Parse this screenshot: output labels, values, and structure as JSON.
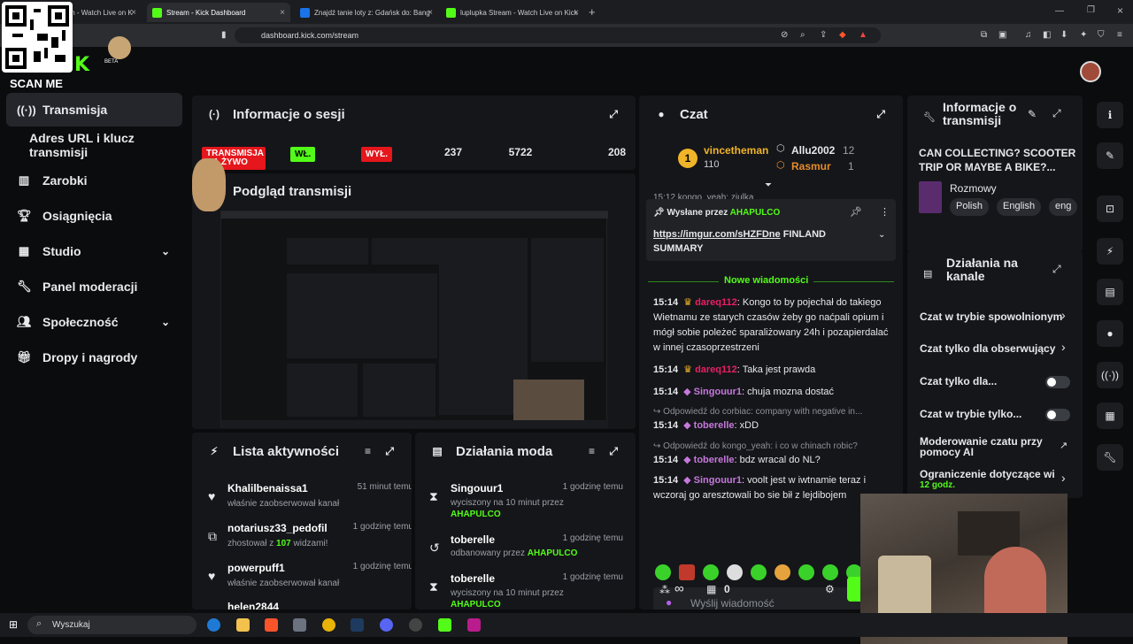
{
  "browser": {
    "tabs": [
      {
        "label": "m - Watch Live on K",
        "active": false
      },
      {
        "label": "Stream - Kick Dashboard",
        "active": true
      },
      {
        "label": "Znajdź tanie loty z: Gdańsk do: Bang",
        "active": false
      },
      {
        "label": "luplupka Stream - Watch Live on Kick",
        "active": false
      }
    ],
    "url": "dashboard.kick.com/stream"
  },
  "overlay": {
    "scan_me": "SCAN ME",
    "beta": "BETA"
  },
  "sidebar": {
    "items": [
      {
        "label": "Transmisja",
        "icon": "broadcast-icon",
        "active": true
      },
      {
        "label": "Adres URL i klucz transmisji",
        "icon": "",
        "active": false
      },
      {
        "label": "Zarobki",
        "icon": "chart-icon",
        "active": false
      },
      {
        "label": "Osiągnięcia",
        "icon": "trophy-icon",
        "active": false
      },
      {
        "label": "Studio",
        "icon": "grid-icon",
        "active": false
      },
      {
        "label": "Panel moderacji",
        "icon": "wrench-icon",
        "active": false
      },
      {
        "label": "Społeczność",
        "icon": "users-icon",
        "active": false
      },
      {
        "label": "Dropy i nagrody",
        "icon": "gift-icon",
        "active": false
      }
    ]
  },
  "session": {
    "title": "Informacje o sesji",
    "live_badge": "TRANSMISJA NA ŻYWO",
    "on": "WŁ.",
    "off": "WYŁ.",
    "stats": [
      "237",
      "5722",
      "208"
    ]
  },
  "preview": {
    "title": "Podgląd transmisji"
  },
  "activity": {
    "title": "Lista aktywności",
    "items": [
      {
        "name": "Khalilbenaissa1",
        "time": "51 minut temu",
        "desc": "właśnie zaobserwował kanał",
        "icon": "heart-icon"
      },
      {
        "name": "notariusz33_pedofil",
        "time": "1 godzinę temu",
        "desc_a": "zhostował z ",
        "count": "107",
        "desc_b": " widzami!",
        "icon": "host-icon"
      },
      {
        "name": "powerpuff1",
        "time": "1 godzinę temu",
        "desc": "właśnie zaobserwował kanał",
        "icon": "heart-icon"
      },
      {
        "name": "helen2844",
        "time": "",
        "desc": "",
        "icon": "heart-icon"
      }
    ]
  },
  "modactions": {
    "title": "Działania moda",
    "items": [
      {
        "name": "Singouur1",
        "time": "1 godzinę temu",
        "desc": "wyciszony na 10 minut przez",
        "by": "AHAPULCO",
        "icon": "hourglass-icon"
      },
      {
        "name": "toberelle",
        "time": "1 godzinę temu",
        "desc": "odbanowany przez",
        "by": "AHAPULCO",
        "icon": "undo-icon"
      },
      {
        "name": "toberelle",
        "time": "1 godzinę temu",
        "desc": "wyciszony na 10 minut przez",
        "by": "AHAPULCO",
        "icon": "hourglass-icon"
      }
    ]
  },
  "chat": {
    "title": "Czat",
    "leaders": [
      {
        "name": "vincetheman",
        "value": "110"
      },
      {
        "name": "Allu2002",
        "value": "12"
      },
      {
        "name": "Rasmur",
        "value": "1"
      }
    ],
    "pinned_by_label": "Wysłane przez",
    "pinned_by": "AHAPULCO",
    "pinned_link": "https://imgur.com/sHZFDne",
    "pinned_text": "FINLAND SUMMARY",
    "top_partial": "15:12 kongo_yeah: ziulka",
    "new_messages": "Nowe wiadomości",
    "messages": [
      {
        "time": "15:14",
        "user": "dareq112",
        "text": "Kongo to by pojechał do takiego Wietnamu ze starych czasów żeby go naćpali opium i mógł sobie poleżeć sparaliżowany 24h i pozapierdalać w innej czasoprzestrzeni"
      },
      {
        "time": "15:14",
        "user": "dareq112",
        "text": "Taka jest prawda"
      },
      {
        "time": "15:14",
        "user": "Singouur1",
        "text": "chuja mozna dostać"
      },
      {
        "time": "15:14",
        "user": "toberelle",
        "text": "xDD",
        "reply": "Odpowiedź do corbiac: company with negative in..."
      },
      {
        "time": "15:14",
        "user": "toberelle",
        "text": "bdz wracal do NL?",
        "reply": "Odpowiedź do kongo_yeah: i co w chinach robic?"
      },
      {
        "time": "15:14",
        "user": "Singouur1",
        "text": "voolt jest w iwtnamie teraz i wczoraj go aresztowali bo sie bił z lejdibojem"
      }
    ],
    "input_placeholder": "Wyślij wiadomość",
    "infinity": "∞",
    "count": "0"
  },
  "stream_info": {
    "title": "Informacje o transmisji",
    "stream_title": "CAN COLLECTING? SCOOTER TRIP OR MAYBE A BIKE?...",
    "category": "Rozmowy",
    "tags": [
      "Polish",
      "English",
      "eng"
    ]
  },
  "channel_actions": {
    "title": "Działania na kanale",
    "items": [
      {
        "label": "Czat w trybie spowolnionym",
        "kind": "chevron"
      },
      {
        "label": "Czat tylko dla obserwujący",
        "kind": "chevron"
      },
      {
        "label": "Czat tylko dla...",
        "kind": "toggle"
      },
      {
        "label": "Czat w trybie tylko...",
        "kind": "toggle"
      },
      {
        "label": "Moderowanie czatu przy pomocy AI",
        "kind": "link"
      },
      {
        "label": "Ograniczenie dotyczące wi",
        "kind": "chevron",
        "sub": "12 godz."
      }
    ]
  },
  "taskbar": {
    "search_placeholder": "Wyszukaj"
  },
  "colors": {
    "accent": "#53fc18",
    "live_red": "#e5161c",
    "panel": "#15161a",
    "bg": "#0b0c0e"
  }
}
